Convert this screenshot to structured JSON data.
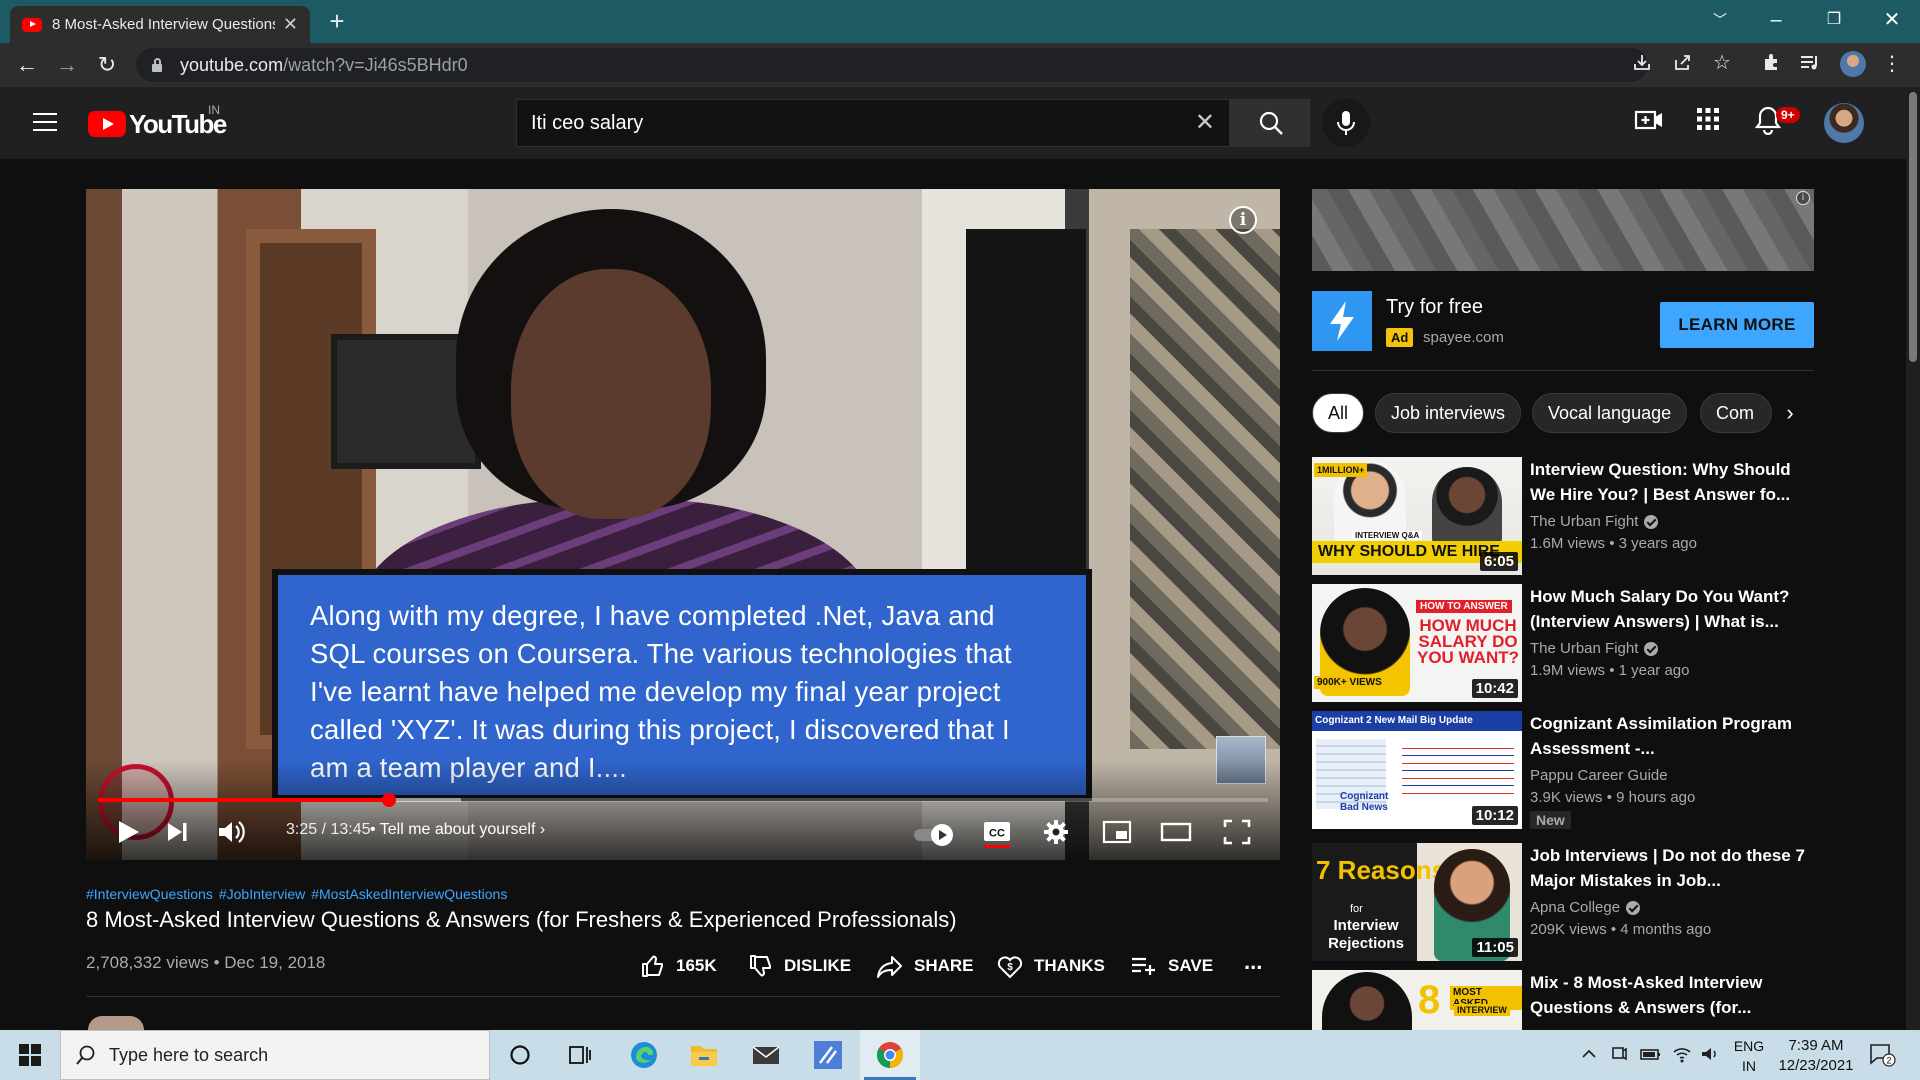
{
  "browser": {
    "tab_title": "8 Most-Asked Interview Questions",
    "url_host": "youtube.com",
    "url_path": "/watch?v=Ji46s5BHdr0"
  },
  "youtube": {
    "logo_text": "YouTube",
    "country_code": "IN",
    "search_value": "Iti ceo salary",
    "notifications_count": "9+"
  },
  "player": {
    "caption_text": "Along with my degree, I have completed .Net, Java and SQL courses on Coursera. The various technologies that I've learnt have helped me develop my final year project called 'XYZ'. It was during this project, I discovered that I am a team player and I....",
    "current_time": "3:25",
    "duration": "13:45",
    "time_display": "3:25 / 13:45",
    "chapter": "• Tell me about yourself",
    "progress_fraction": 0.249,
    "buffered_fraction": 0.31,
    "info_glyph": "i"
  },
  "video": {
    "hashtags": [
      "#InterviewQuestions",
      "#JobInterview",
      "#MostAskedInterviewQuestions"
    ],
    "title": "8 Most-Asked Interview Questions & Answers (for Freshers & Experienced Professionals)",
    "views_date": "2,708,332 views • Dec 19, 2018",
    "actions": {
      "like_count": "165K",
      "dislike": "DISLIKE",
      "share": "SHARE",
      "thanks": "THANKS",
      "save": "SAVE",
      "more": "..."
    }
  },
  "ad": {
    "title": "Try for free",
    "badge": "Ad",
    "domain": "spayee.com",
    "cta": "LEARN MORE",
    "info_glyph": "i"
  },
  "chips": [
    "All",
    "Job interviews",
    "Vocal language",
    "Com"
  ],
  "recommendations": [
    {
      "title": "Interview Question: Why Should We Hire You? | Best Answer fo...",
      "channel": "The Urban Fight",
      "meta": "1.6M views • 3 years ago",
      "duration": "6:05",
      "thumb_top": "1MILLION+",
      "thumb_caption": "WHY SHOULD WE HIRE",
      "thumb_tag": "INTERVIEW Q&A",
      "badge": ""
    },
    {
      "title": "How Much Salary Do You Want? (Interview Answers) | What is...",
      "channel": "The Urban Fight",
      "meta": "1.9M views • 1 year ago",
      "duration": "10:42",
      "thumb_top": "HOW TO ANSWER",
      "thumb_caption": "HOW MUCH SALARY DO YOU WANT?",
      "thumb_tag": "900K+ VIEWS",
      "badge": ""
    },
    {
      "title": "Cognizant Assimilation Program Assessment -...",
      "channel": "Pappu Career Guide",
      "meta": "3.9K views • 9 hours ago",
      "duration": "10:12",
      "thumb_top": "Cognizant 2 New Mail Big Update",
      "thumb_caption": "Cognizant Bad News",
      "thumb_tag": "",
      "badge": "New"
    },
    {
      "title": "Job Interviews | Do not do these 7 Major Mistakes in Job...",
      "channel": "Apna College",
      "meta": "209K views • 4 months ago",
      "duration": "11:05",
      "thumb_top": "7 Reasons",
      "thumb_caption": "Interview Rejections",
      "thumb_tag": "for",
      "badge": ""
    },
    {
      "title": "Mix - 8 Most-Asked Interview Questions & Answers (for...",
      "channel": "",
      "meta": "",
      "duration": "",
      "thumb_top": "MOST ASKED",
      "thumb_caption": "INTERVIEW",
      "thumb_tag": "8",
      "badge": ""
    }
  ],
  "taskbar": {
    "search_placeholder": "Type here to search",
    "lang_top": "ENG",
    "lang_bottom": "IN",
    "time": "7:39 AM",
    "date": "12/23/2021",
    "notification_count": "2"
  },
  "colors": {
    "yt_red": "#ff0000",
    "link_blue": "#3ea6ff",
    "caption_blue": "#2f65cc",
    "ad_yellow": "#f4c20d",
    "tabstrip": "#1e5a63"
  }
}
